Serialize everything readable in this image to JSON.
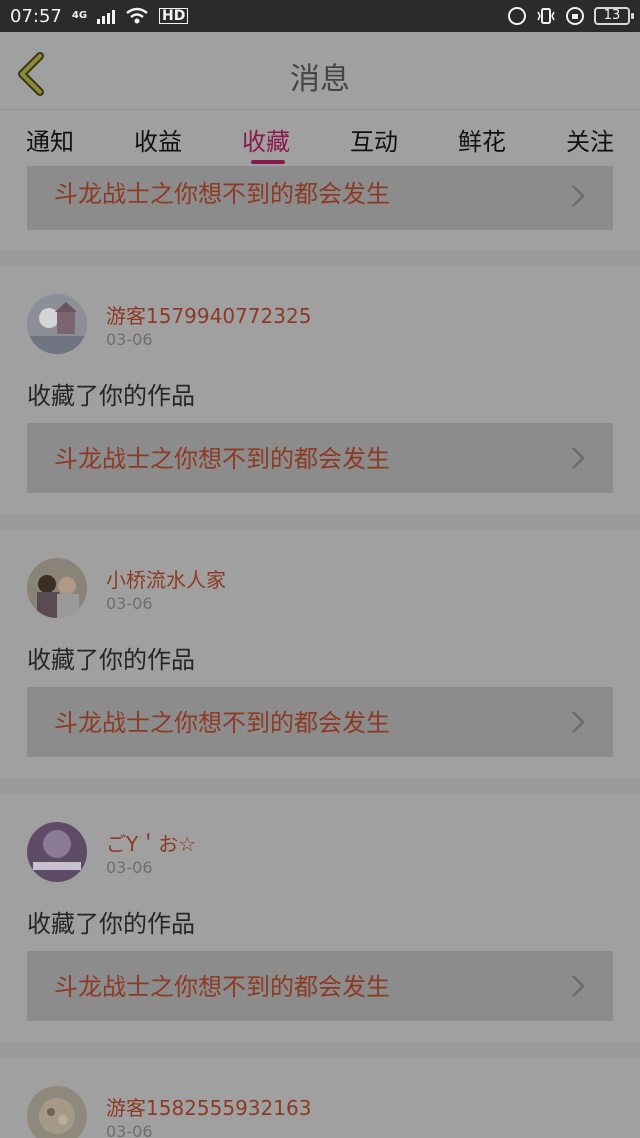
{
  "status": {
    "time": "07:57",
    "network": "4G",
    "hd": "HD",
    "battery": "13"
  },
  "header": {
    "title": "消息"
  },
  "tabs": [
    {
      "label": "通知"
    },
    {
      "label": "收益"
    },
    {
      "label": "收藏",
      "active": true
    },
    {
      "label": "互动"
    },
    {
      "label": "鲜花"
    },
    {
      "label": "关注"
    }
  ],
  "first_card": {
    "work_title": "斗龙战士之你想不到的都会发生"
  },
  "messages": [
    {
      "user": "游客1579940772325",
      "date": "03-06",
      "action": "收藏了你的作品",
      "work_title": "斗龙战士之你想不到的都会发生"
    },
    {
      "user": "小桥流水人家",
      "date": "03-06",
      "action": "收藏了你的作品",
      "work_title": "斗龙战士之你想不到的都会发生"
    },
    {
      "user": "ごY＇お☆",
      "date": "03-06",
      "action": "收藏了你的作品",
      "work_title": "斗龙战士之你想不到的都会发生"
    },
    {
      "user": "游客1582555932163",
      "date": "03-06"
    }
  ],
  "colors": {
    "accent": "#8b1a4c",
    "link_text": "#8c3a24",
    "overlay_bg": "#9a9a9a"
  }
}
